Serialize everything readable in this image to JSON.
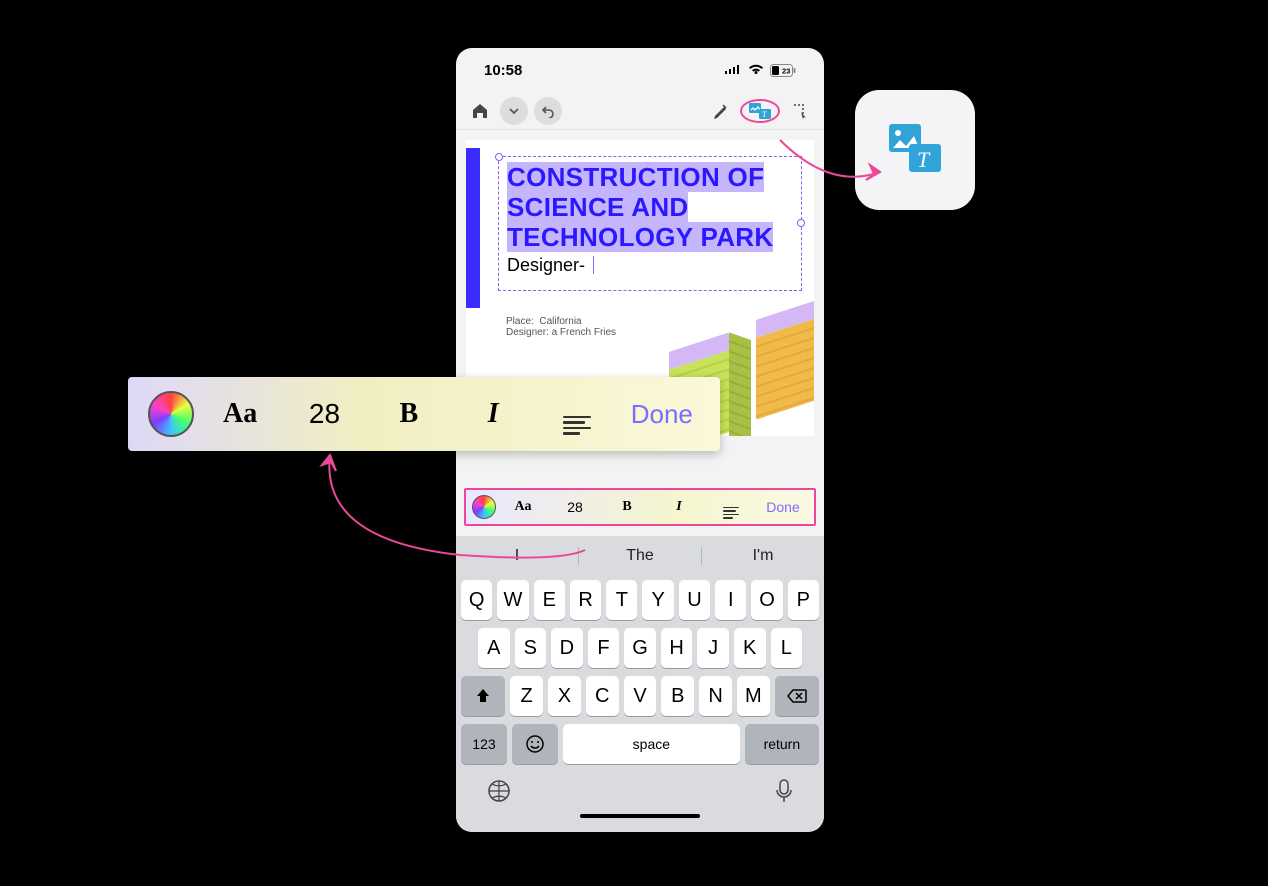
{
  "status": {
    "time": "10:58",
    "battery": "23"
  },
  "doc": {
    "headline": "CONSTRUCTION OF SCIENCE AND TECHNOLOGY PARK",
    "subline_prefix": "Designer- ",
    "meta_place_label": "Place:",
    "meta_place_value": "California",
    "meta_designer_label": "Designer:",
    "meta_designer_value": "a French Fries"
  },
  "format": {
    "font_btn": "Aa",
    "size": "28",
    "bold": "B",
    "italic": "I",
    "done": "Done"
  },
  "predictions": [
    "I",
    "The",
    "I'm"
  ],
  "keyboard": {
    "row1": [
      "Q",
      "W",
      "E",
      "R",
      "T",
      "Y",
      "U",
      "I",
      "O",
      "P"
    ],
    "row2": [
      "A",
      "S",
      "D",
      "F",
      "G",
      "H",
      "J",
      "K",
      "L"
    ],
    "row3": [
      "Z",
      "X",
      "C",
      "V",
      "B",
      "N",
      "M"
    ],
    "numeric": "123",
    "space": "space",
    "return": "return"
  }
}
